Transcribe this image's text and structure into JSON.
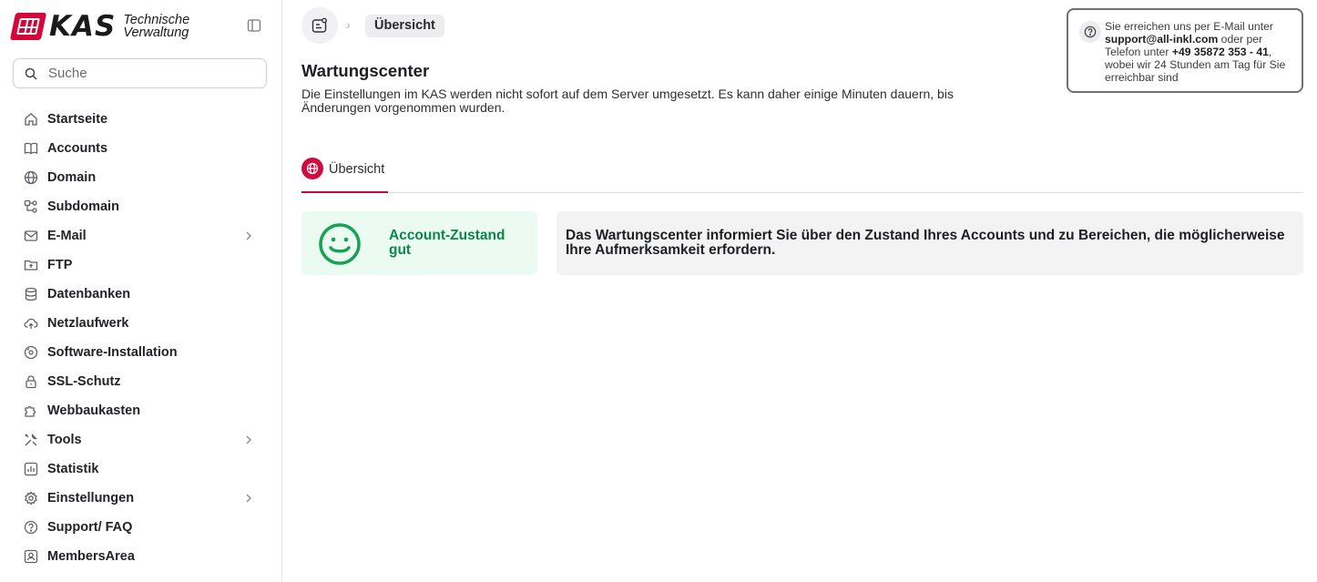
{
  "app": {
    "logo_text": "KAS",
    "logo_subtitle_line1": "Technische",
    "logo_subtitle_line2": "Verwaltung",
    "brand_color": "#d4073b"
  },
  "search": {
    "placeholder": "Suche"
  },
  "sidebar": {
    "items": [
      {
        "label": "Startseite",
        "icon": "home-icon",
        "has_submenu": false
      },
      {
        "label": "Accounts",
        "icon": "book-icon",
        "has_submenu": false
      },
      {
        "label": "Domain",
        "icon": "globe-icon",
        "has_submenu": false
      },
      {
        "label": "Subdomain",
        "icon": "subdomain-icon",
        "has_submenu": false
      },
      {
        "label": "E-Mail",
        "icon": "mail-icon",
        "has_submenu": true
      },
      {
        "label": "FTP",
        "icon": "folder-icon",
        "has_submenu": false
      },
      {
        "label": "Datenbanken",
        "icon": "database-icon",
        "has_submenu": false
      },
      {
        "label": "Netzlaufwerk",
        "icon": "cloud-upload-icon",
        "has_submenu": false
      },
      {
        "label": "Software-Installation",
        "icon": "disc-icon",
        "has_submenu": false
      },
      {
        "label": "SSL-Schutz",
        "icon": "lock-icon",
        "has_submenu": false
      },
      {
        "label": "Webbaukasten",
        "icon": "puzzle-icon",
        "has_submenu": false
      },
      {
        "label": "Tools",
        "icon": "tools-icon",
        "has_submenu": true
      },
      {
        "label": "Statistik",
        "icon": "chart-icon",
        "has_submenu": false
      },
      {
        "label": "Einstellungen",
        "icon": "gear-icon",
        "has_submenu": true
      },
      {
        "label": "Support/ FAQ",
        "icon": "help-circle-icon",
        "has_submenu": false
      },
      {
        "label": "MembersArea",
        "icon": "id-card-icon",
        "has_submenu": false
      }
    ]
  },
  "breadcrumb": {
    "current": "Übersicht"
  },
  "page": {
    "title": "Wartungscenter",
    "description": "Die Einstellungen im KAS werden nicht sofort auf dem Server umgesetzt. Es kann daher einige Minuten dauern, bis Änderungen vorgenommen wurden."
  },
  "help": {
    "text_before_email": "Sie erreichen uns per E-Mail unter ",
    "email": "support@all-inkl.com",
    "text_before_phone": " oder per Telefon unter ",
    "phone": "+49 35872 353 - 41",
    "text_after": ", wobei wir 24 Stunden am Tag für Sie erreichbar sind"
  },
  "tabs": [
    {
      "label": "Übersicht",
      "active": true
    }
  ],
  "status": {
    "label": "Account-Zustand gut",
    "color": "#0a8648"
  },
  "info": {
    "text": "Das Wartungscenter informiert Sie über den Zustand Ihres Accounts und zu Bereichen, die möglicherweise Ihre Aufmerksamkeit erfordern."
  }
}
